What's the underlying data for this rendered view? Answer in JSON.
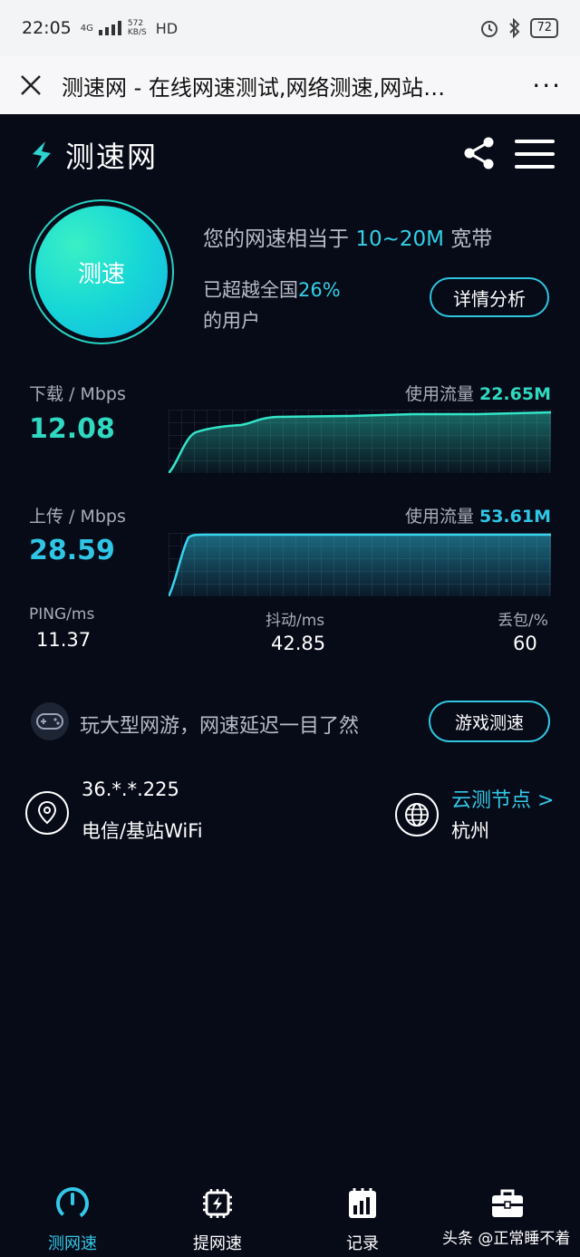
{
  "status_bar": {
    "time": "22:05",
    "net_type": "4G",
    "net_speed_value": "572",
    "net_speed_unit": "KB/S",
    "hd": "HD",
    "battery": "72"
  },
  "browser": {
    "title": "测速网 - 在线网速测试,网络测速,网站…",
    "more": "···"
  },
  "app": {
    "logo_text": "测速网"
  },
  "test_button": {
    "label": "测速"
  },
  "summary": {
    "equiv_prefix": "您的网速相当于",
    "equiv_value": "10~20M",
    "equiv_suffix": "宽带",
    "surpass_prefix": "已超越全国",
    "surpass_percent": "26%",
    "surpass_suffix": "的用户",
    "detail_button": "详情分析"
  },
  "download": {
    "label": "下载 / Mbps",
    "value": "12.08",
    "usage_label": "使用流量",
    "usage_value": "22.65M"
  },
  "upload": {
    "label": "上传 / Mbps",
    "value": "28.59",
    "usage_label": "使用流量",
    "usage_value": "53.61M"
  },
  "stats": {
    "ping_label": "PING/ms",
    "ping_value": "11.37",
    "jitter_label": "抖动/ms",
    "jitter_value": "42.85",
    "loss_label": "丢包/%",
    "loss_value": "60"
  },
  "game": {
    "text": "玩大型网游，网速延迟一目了然",
    "button": "游戏测速"
  },
  "network": {
    "ip": "36.*.*.225",
    "isp": "电信/基站WiFi",
    "node_label": "云测节点 >",
    "city": "杭州"
  },
  "nav": [
    {
      "label": "测网速"
    },
    {
      "label": "提网速"
    },
    {
      "label": "记录"
    }
  ],
  "watermark": "头条 @正常睡不着",
  "colors": {
    "accent": "#33c8e8",
    "download": "#2fd9c1",
    "background": "#070a17"
  }
}
